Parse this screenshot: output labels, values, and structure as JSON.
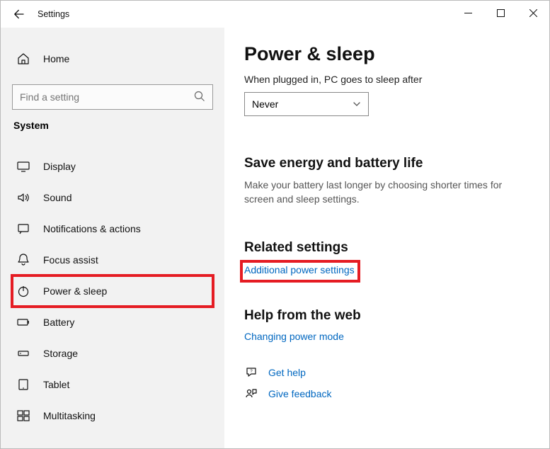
{
  "window": {
    "title": "Settings"
  },
  "sidebar": {
    "home_label": "Home",
    "search_placeholder": "Find a setting",
    "category_label": "System",
    "items": [
      {
        "label": "Display"
      },
      {
        "label": "Sound"
      },
      {
        "label": "Notifications & actions"
      },
      {
        "label": "Focus assist"
      },
      {
        "label": "Power & sleep"
      },
      {
        "label": "Battery"
      },
      {
        "label": "Storage"
      },
      {
        "label": "Tablet"
      },
      {
        "label": "Multitasking"
      }
    ]
  },
  "main": {
    "title": "Power & sleep",
    "plugged_label": "When plugged in, PC goes to sleep after",
    "plugged_value": "Never",
    "energy_heading": "Save energy and battery life",
    "energy_body": "Make your battery last longer by choosing shorter times for screen and sleep settings.",
    "related_heading": "Related settings",
    "related_link": "Additional power settings",
    "help_heading": "Help from the web",
    "help_link": "Changing power mode",
    "get_help_label": "Get help",
    "give_feedback_label": "Give feedback"
  }
}
